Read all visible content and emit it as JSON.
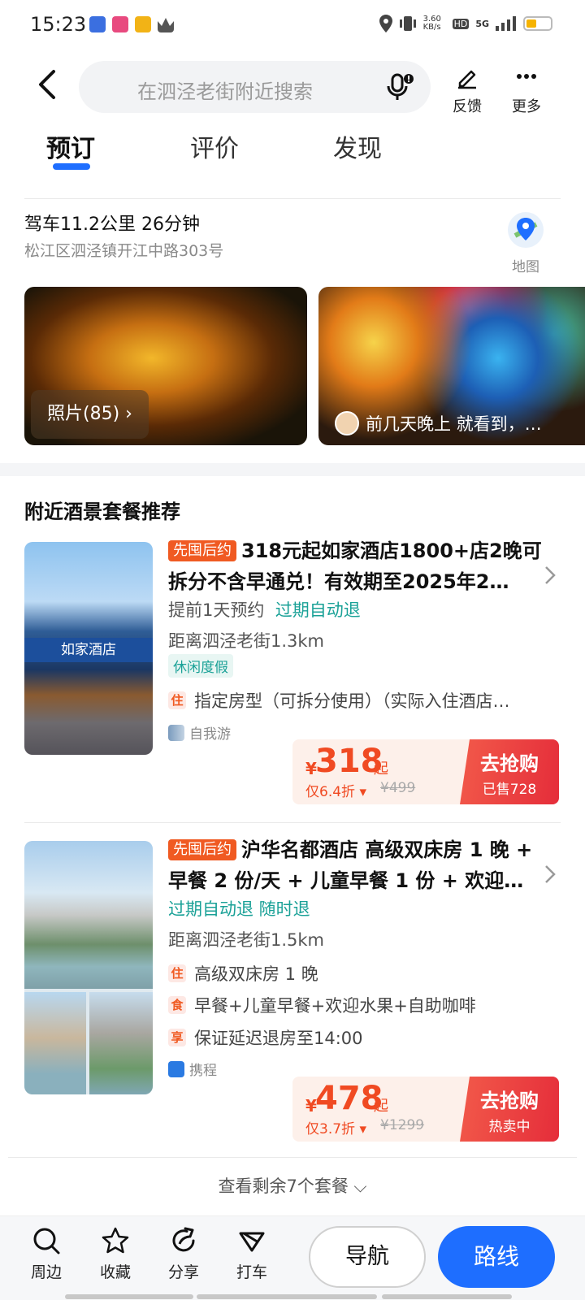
{
  "status": {
    "time": "15:23",
    "net_speed": "3.60\nKB/s",
    "hd": "HD",
    "net": "5G"
  },
  "search": {
    "placeholder": "在泗泾老街附近搜索"
  },
  "top_actions": {
    "feedback": "反馈",
    "more": "更多"
  },
  "tabs": [
    {
      "label": "预订"
    },
    {
      "label": "评价"
    },
    {
      "label": "发现"
    }
  ],
  "location": {
    "drive": "驾车11.2公里 26分钟",
    "address": "松江区泗泾镇开江中路303号",
    "map_label": "地图"
  },
  "photos": {
    "count_label": "照片(85)",
    "review_snippet": "前几天晚上 就看到，…"
  },
  "section_title": "附近酒景套餐推荐",
  "packages": [
    {
      "badge": "先囤后约",
      "title": "318元起如家酒店1800+店2晚可拆分不含早通兑！有效期至2025年2…",
      "booking": "提前1天预约",
      "refund": "过期自动退",
      "distance": "距离泗泾老街1.3km",
      "tag": "休闲度假",
      "perks": [
        {
          "key": "住",
          "text": "指定房型（可拆分使用）（实际入住酒店…"
        }
      ],
      "source": "自我游",
      "thumb_sign": "如家酒店",
      "price": {
        "yen": "¥",
        "amount": "318",
        "qi": "起",
        "discount": "仅6.4折 ▾",
        "original": "¥499"
      },
      "cta": {
        "label": "去抢购",
        "sub": "已售728"
      }
    },
    {
      "badge": "先囤后约",
      "title": "沪华名都酒店 高级双床房 1 晚 + 早餐 2 份/天 + 儿童早餐 1 份 + 欢迎…",
      "booking": "过期自动退 随时退",
      "distance": "距离泗泾老街1.5km",
      "perks": [
        {
          "key": "住",
          "text": "高级双床房 1 晚"
        },
        {
          "key": "食",
          "text": "早餐+儿童早餐+欢迎水果+自助咖啡"
        },
        {
          "key": "享",
          "text": "保证延迟退房至14:00"
        }
      ],
      "source": "携程",
      "price": {
        "yen": "¥",
        "amount": "478",
        "qi": "起",
        "discount": "仅3.7折 ▾",
        "original": "¥1299"
      },
      "cta": {
        "label": "去抢购",
        "sub": "热卖中"
      }
    }
  ],
  "more_packages": "查看剩余7个套餐 ⌵",
  "bottom_bar": {
    "nearby": "周边",
    "favorite": "收藏",
    "share": "分享",
    "taxi": "打车",
    "navigate": "导航",
    "route": "路线"
  },
  "colors": {
    "accent": "#1e6eff",
    "price": "#f04a22",
    "teal": "#1aa197"
  }
}
